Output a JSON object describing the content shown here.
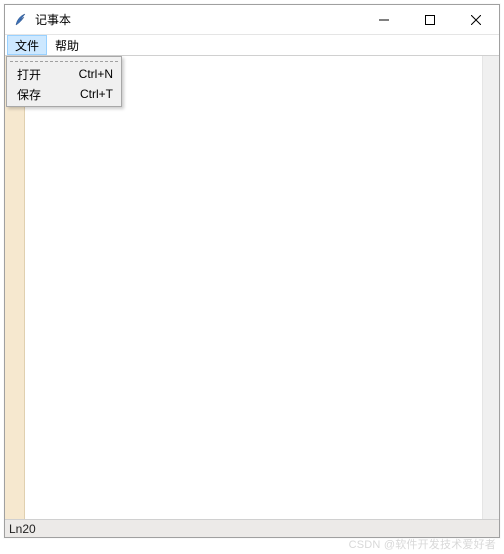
{
  "window": {
    "title": "记事本"
  },
  "menubar": {
    "items": [
      {
        "label": "文件",
        "active": true
      },
      {
        "label": "帮助",
        "active": false
      }
    ]
  },
  "file_menu": {
    "items": [
      {
        "label": "打开",
        "accelerator": "Ctrl+N"
      },
      {
        "label": "保存",
        "accelerator": "Ctrl+T"
      }
    ]
  },
  "statusbar": {
    "text": "Ln20"
  },
  "watermark": {
    "text": "CSDN @软件开发技术爱好者"
  }
}
